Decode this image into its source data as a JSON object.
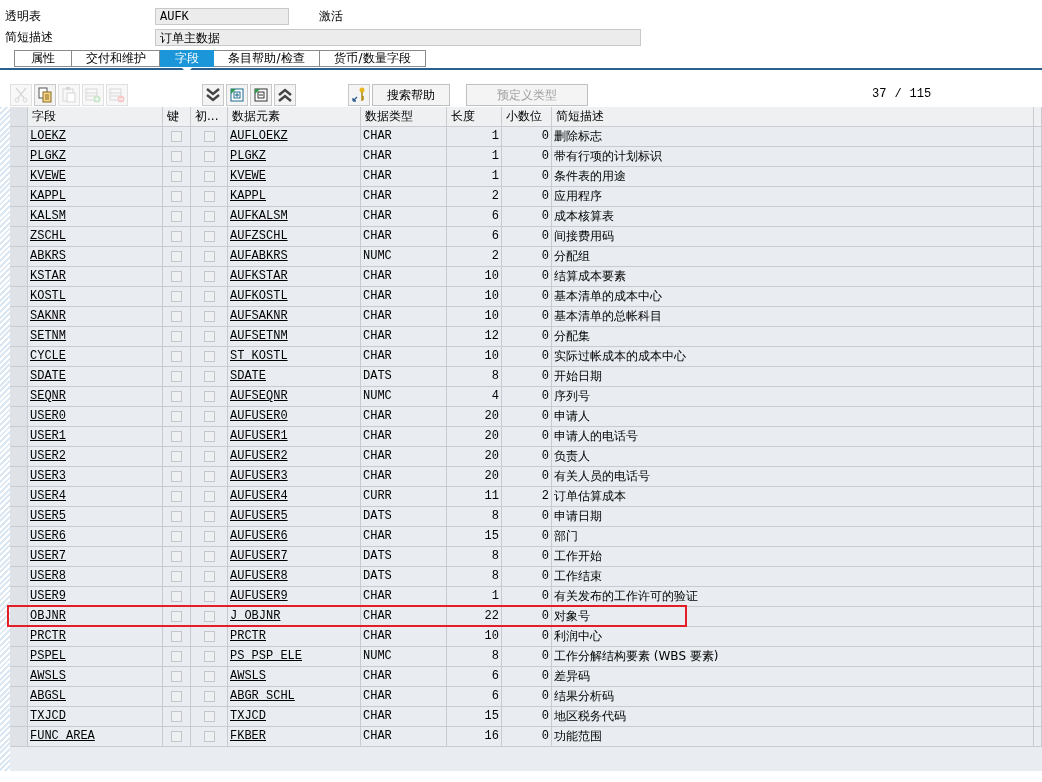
{
  "header": {
    "type_label": "透明表",
    "table_name": "AUFK",
    "status": "激活",
    "desc_label": "简短描述",
    "description": "订单主数据"
  },
  "tabs": [
    {
      "label": "属性",
      "selected": false
    },
    {
      "label": "交付和维护",
      "selected": false
    },
    {
      "label": "字段",
      "selected": true
    },
    {
      "label": "条目帮助/检查",
      "selected": false
    },
    {
      "label": "货币/数量字段",
      "selected": false
    }
  ],
  "toolbar": [
    [
      {
        "kind": "cut",
        "disabled": true
      },
      {
        "kind": "copy",
        "disabled": false
      },
      {
        "kind": "paste",
        "disabled": true
      },
      {
        "kind": "insert-row",
        "disabled": true
      },
      {
        "kind": "delete-row",
        "disabled": true
      }
    ],
    [
      {
        "kind": "expand",
        "disabled": false
      },
      {
        "kind": "select-block",
        "disabled": false
      },
      {
        "kind": "deselect-block",
        "disabled": false
      },
      {
        "kind": "collapse",
        "disabled": false
      }
    ],
    [
      {
        "kind": "key",
        "disabled": false
      },
      {
        "kind": "text",
        "label": "搜索帮助",
        "disabled": false
      },
      {
        "kind": "text",
        "label": "预定义类型",
        "disabled": true
      }
    ]
  ],
  "counter": {
    "current": "37",
    "separator": "/",
    "total": "115"
  },
  "columns": [
    "字段",
    "键",
    "初...",
    "数据元素",
    "数据类型",
    "长度",
    "小数位",
    "简短描述"
  ],
  "rows": [
    {
      "field": "LOEKZ",
      "key": false,
      "init": false,
      "element": "AUFLOEKZ",
      "type": "CHAR",
      "length": "1",
      "decimals": "0",
      "description": "删除标志",
      "highlighted": false
    },
    {
      "field": "PLGKZ",
      "key": false,
      "init": false,
      "element": "PLGKZ",
      "type": "CHAR",
      "length": "1",
      "decimals": "0",
      "description": "带有行项的计划标识",
      "highlighted": false
    },
    {
      "field": "KVEWE",
      "key": false,
      "init": false,
      "element": "KVEWE",
      "type": "CHAR",
      "length": "1",
      "decimals": "0",
      "description": "条件表的用途",
      "highlighted": false
    },
    {
      "field": "KAPPL",
      "key": false,
      "init": false,
      "element": "KAPPL",
      "type": "CHAR",
      "length": "2",
      "decimals": "0",
      "description": "应用程序",
      "highlighted": false
    },
    {
      "field": "KALSM",
      "key": false,
      "init": false,
      "element": "AUFKALSM",
      "type": "CHAR",
      "length": "6",
      "decimals": "0",
      "description": "成本核算表",
      "highlighted": false
    },
    {
      "field": "ZSCHL",
      "key": false,
      "init": false,
      "element": "AUFZSCHL",
      "type": "CHAR",
      "length": "6",
      "decimals": "0",
      "description": "间接费用码",
      "highlighted": false
    },
    {
      "field": "ABKRS",
      "key": false,
      "init": false,
      "element": "AUFABKRS",
      "type": "NUMC",
      "length": "2",
      "decimals": "0",
      "description": "分配组",
      "highlighted": false
    },
    {
      "field": "KSTAR",
      "key": false,
      "init": false,
      "element": "AUFKSTAR",
      "type": "CHAR",
      "length": "10",
      "decimals": "0",
      "description": "结算成本要素",
      "highlighted": false
    },
    {
      "field": "KOSTL",
      "key": false,
      "init": false,
      "element": "AUFKOSTL",
      "type": "CHAR",
      "length": "10",
      "decimals": "0",
      "description": "基本清单的成本中心",
      "highlighted": false
    },
    {
      "field": "SAKNR",
      "key": false,
      "init": false,
      "element": "AUFSAKNR",
      "type": "CHAR",
      "length": "10",
      "decimals": "0",
      "description": "基本清单的总帐科目",
      "highlighted": false
    },
    {
      "field": "SETNM",
      "key": false,
      "init": false,
      "element": "AUFSETNM",
      "type": "CHAR",
      "length": "12",
      "decimals": "0",
      "description": "分配集",
      "highlighted": false
    },
    {
      "field": "CYCLE",
      "key": false,
      "init": false,
      "element": "ST_KOSTL",
      "type": "CHAR",
      "length": "10",
      "decimals": "0",
      "description": "实际过帐成本的成本中心",
      "highlighted": false
    },
    {
      "field": "SDATE",
      "key": false,
      "init": false,
      "element": "SDATE",
      "type": "DATS",
      "length": "8",
      "decimals": "0",
      "description": "开始日期",
      "highlighted": false
    },
    {
      "field": "SEQNR",
      "key": false,
      "init": false,
      "element": "AUFSEQNR",
      "type": "NUMC",
      "length": "4",
      "decimals": "0",
      "description": "序列号",
      "highlighted": false
    },
    {
      "field": "USER0",
      "key": false,
      "init": false,
      "element": "AUFUSER0",
      "type": "CHAR",
      "length": "20",
      "decimals": "0",
      "description": "申请人",
      "highlighted": false
    },
    {
      "field": "USER1",
      "key": false,
      "init": false,
      "element": "AUFUSER1",
      "type": "CHAR",
      "length": "20",
      "decimals": "0",
      "description": "申请人的电话号",
      "highlighted": false
    },
    {
      "field": "USER2",
      "key": false,
      "init": false,
      "element": "AUFUSER2",
      "type": "CHAR",
      "length": "20",
      "decimals": "0",
      "description": "负责人",
      "highlighted": false
    },
    {
      "field": "USER3",
      "key": false,
      "init": false,
      "element": "AUFUSER3",
      "type": "CHAR",
      "length": "20",
      "decimals": "0",
      "description": "有关人员的电话号",
      "highlighted": false
    },
    {
      "field": "USER4",
      "key": false,
      "init": false,
      "element": "AUFUSER4",
      "type": "CURR",
      "length": "11",
      "decimals": "2",
      "description": "订单估算成本",
      "highlighted": false
    },
    {
      "field": "USER5",
      "key": false,
      "init": false,
      "element": "AUFUSER5",
      "type": "DATS",
      "length": "8",
      "decimals": "0",
      "description": "申请日期",
      "highlighted": false
    },
    {
      "field": "USER6",
      "key": false,
      "init": false,
      "element": "AUFUSER6",
      "type": "CHAR",
      "length": "15",
      "decimals": "0",
      "description": "部门",
      "highlighted": false
    },
    {
      "field": "USER7",
      "key": false,
      "init": false,
      "element": "AUFUSER7",
      "type": "DATS",
      "length": "8",
      "decimals": "0",
      "description": "工作开始",
      "highlighted": false
    },
    {
      "field": "USER8",
      "key": false,
      "init": false,
      "element": "AUFUSER8",
      "type": "DATS",
      "length": "8",
      "decimals": "0",
      "description": "工作结束",
      "highlighted": false
    },
    {
      "field": "USER9",
      "key": false,
      "init": false,
      "element": "AUFUSER9",
      "type": "CHAR",
      "length": "1",
      "decimals": "0",
      "description": "有关发布的工作许可的验证",
      "highlighted": false
    },
    {
      "field": "OBJNR",
      "key": false,
      "init": false,
      "element": "J_OBJNR",
      "type": "CHAR",
      "length": "22",
      "decimals": "0",
      "description": "对象号",
      "highlighted": true
    },
    {
      "field": "PRCTR",
      "key": false,
      "init": false,
      "element": "PRCTR",
      "type": "CHAR",
      "length": "10",
      "decimals": "0",
      "description": "利润中心",
      "highlighted": false
    },
    {
      "field": "PSPEL",
      "key": false,
      "init": false,
      "element": "PS_PSP_ELE",
      "type": "NUMC",
      "length": "8",
      "decimals": "0",
      "description": "工作分解结构要素 (WBS 要素)",
      "highlighted": false
    },
    {
      "field": "AWSLS",
      "key": false,
      "init": false,
      "element": "AWSLS",
      "type": "CHAR",
      "length": "6",
      "decimals": "0",
      "description": "差异码",
      "highlighted": false
    },
    {
      "field": "ABGSL",
      "key": false,
      "init": false,
      "element": "ABGR_SCHL",
      "type": "CHAR",
      "length": "6",
      "decimals": "0",
      "description": "结果分析码",
      "highlighted": false
    },
    {
      "field": "TXJCD",
      "key": false,
      "init": false,
      "element": "TXJCD",
      "type": "CHAR",
      "length": "15",
      "decimals": "0",
      "description": "地区税务代码",
      "highlighted": false
    },
    {
      "field": "FUNC_AREA",
      "key": false,
      "init": false,
      "element": "FKBER",
      "type": "CHAR",
      "length": "16",
      "decimals": "0",
      "description": "功能范围",
      "highlighted": false
    }
  ]
}
